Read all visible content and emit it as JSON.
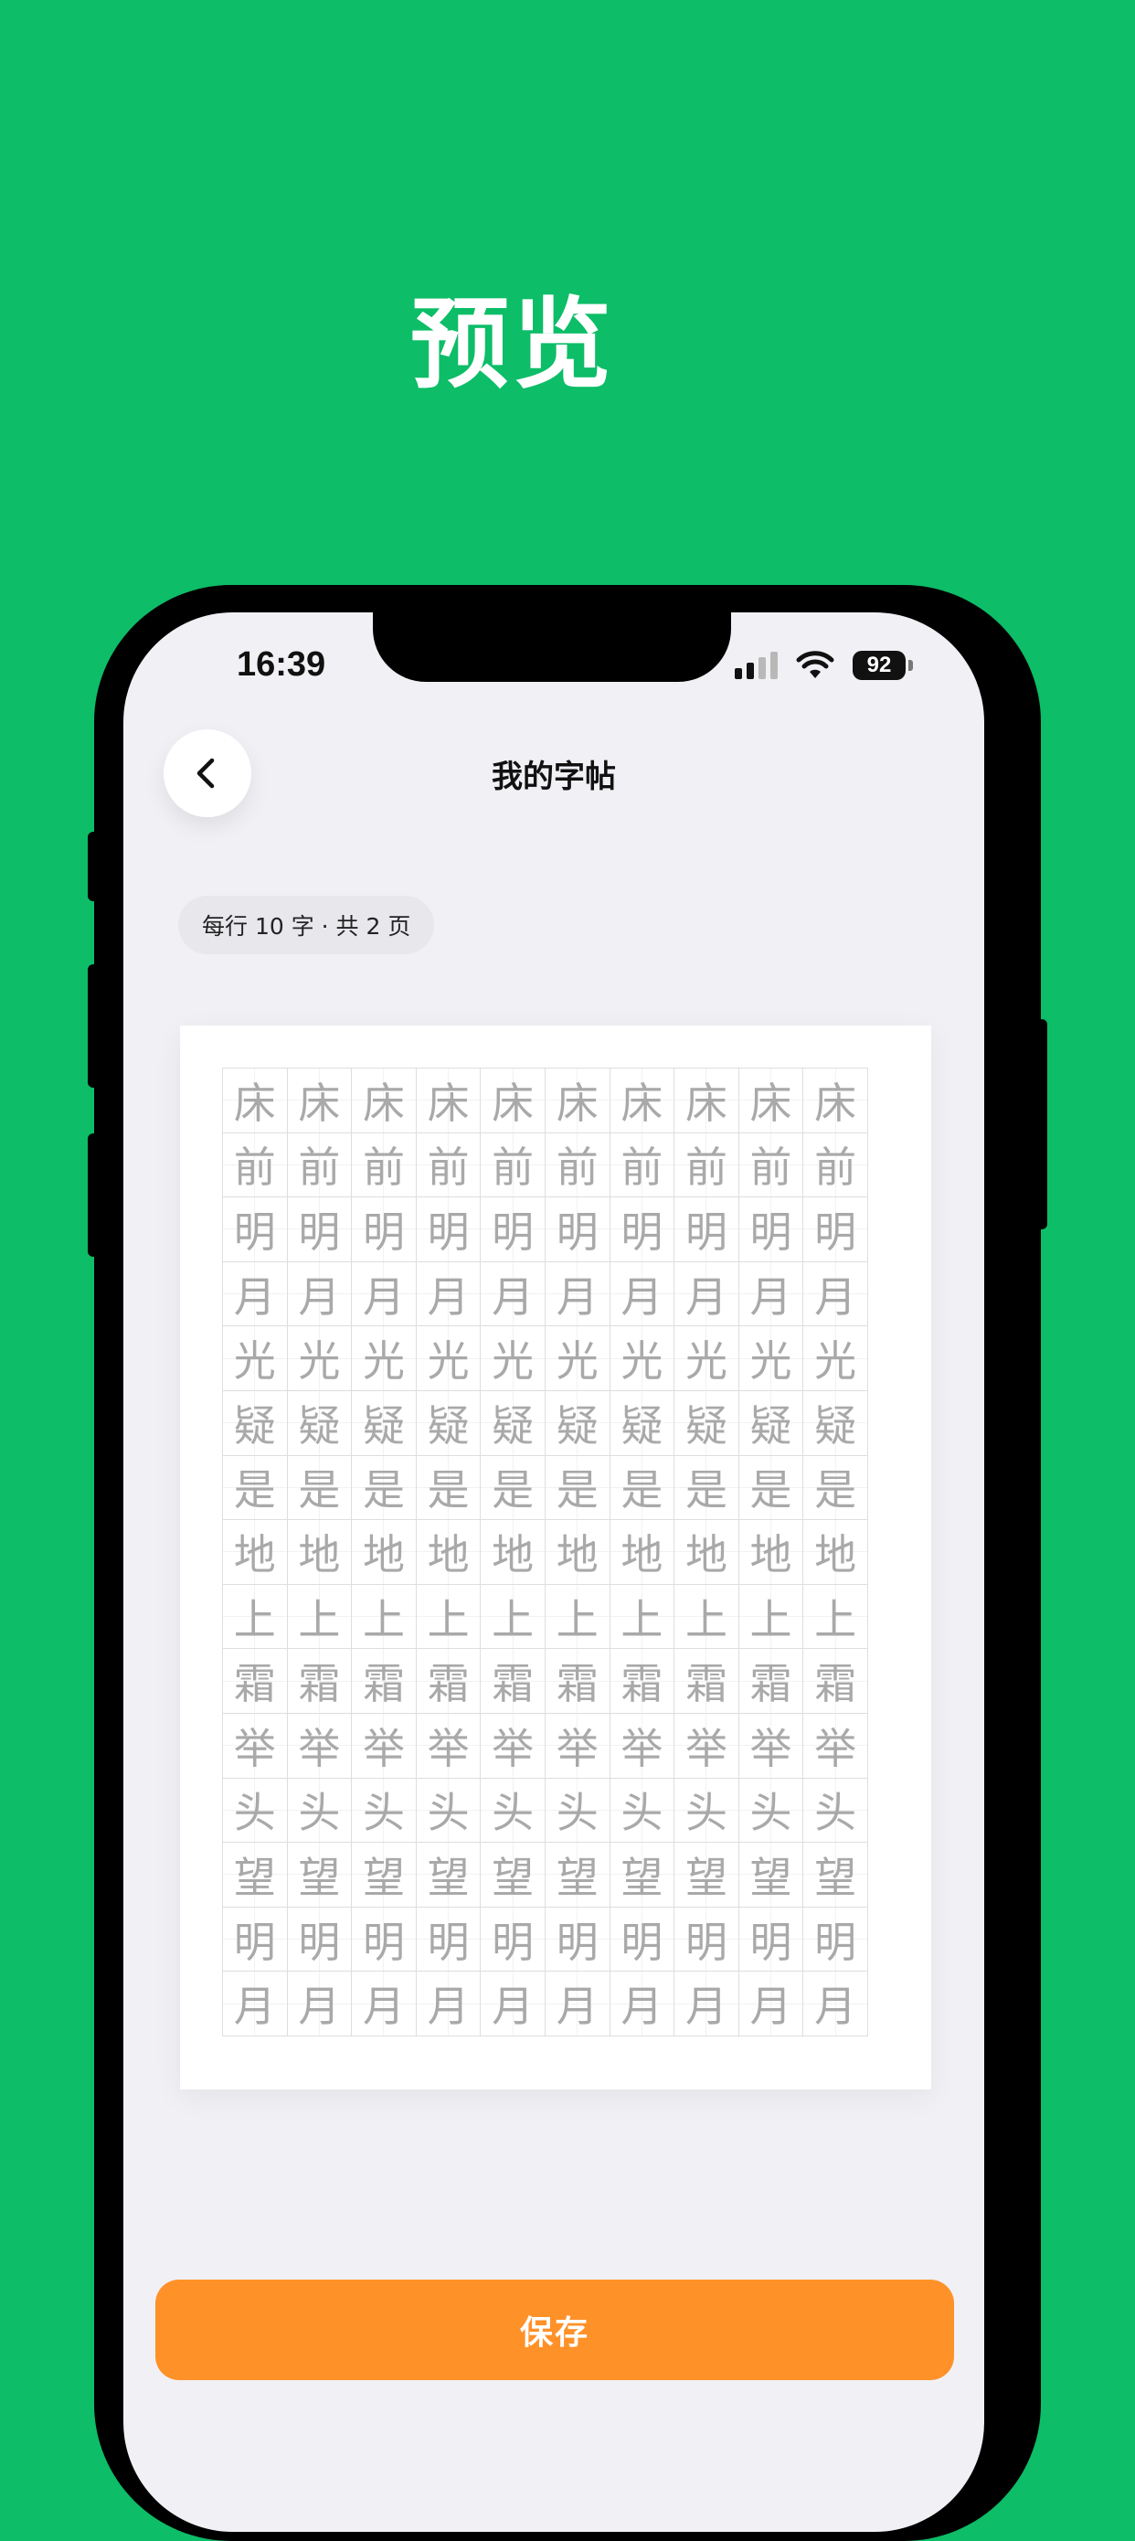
{
  "promo": {
    "headline": "预览"
  },
  "status_bar": {
    "time": "16:39",
    "battery": "92"
  },
  "nav": {
    "title": "我的字帖",
    "back_icon": "chevron-left-icon"
  },
  "info": {
    "text": "每行 10 字 · 共 2 页"
  },
  "sheet": {
    "chars_per_row": 10,
    "rows": [
      "床",
      "前",
      "明",
      "月",
      "光",
      "疑",
      "是",
      "地",
      "上",
      "霜",
      "举",
      "头",
      "望",
      "明",
      "月"
    ]
  },
  "actions": {
    "save_label": "保存"
  },
  "colors": {
    "background": "#0dbd68",
    "accent": "#ff9129",
    "screen": "#f1f1f5",
    "character": "#a9a9a9"
  }
}
